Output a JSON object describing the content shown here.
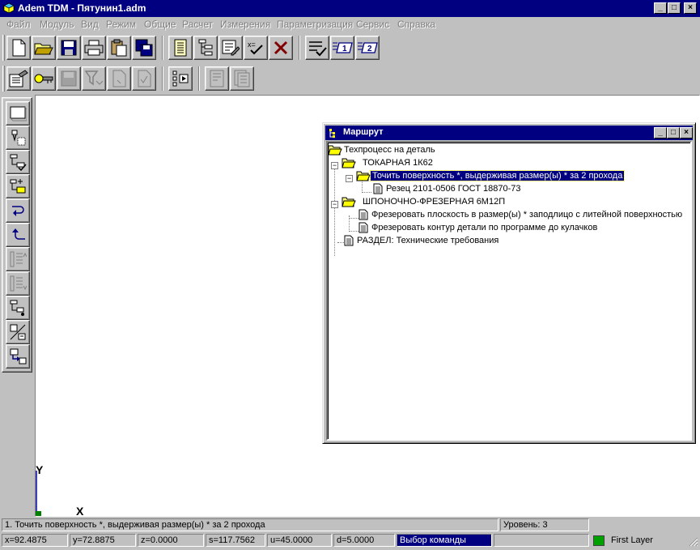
{
  "window": {
    "title": "Adem TDM - Пятунин1.adm",
    "minimize": "_",
    "maximize": "□",
    "close": "×"
  },
  "menu": [
    "Файл",
    "Модуль",
    "Вид",
    "Режим",
    "Общие",
    "Расчет",
    "Измерения",
    "Параметризация",
    "Сервис",
    "Справка"
  ],
  "toolbar1": {
    "buttons": [
      "new-file-icon",
      "open-folder-icon",
      "save-disk-icon",
      "print-icon",
      "paste-icon",
      "save-as-icon",
      "document-icon",
      "tree-icon",
      "edit-tree-icon",
      "formula-icon",
      "delete-icon",
      "checklist-icon",
      "level-1-icon",
      "level-2-icon"
    ],
    "label_level1": "1",
    "label_level2": "2",
    "label_formula": "x="
  },
  "toolbar2": {
    "buttons": [
      "properties-icon",
      "link-icon",
      "save-disabled-icon",
      "filter-disabled-icon",
      "page-disabled-icon",
      "check-disabled-icon",
      "list-run-icon",
      "page-sheet-disabled-icon",
      "report-disabled-icon"
    ]
  },
  "left_toolbar": {
    "buttons": [
      "frame-icon",
      "operation-add-icon",
      "route-check-icon",
      "insert-step-icon",
      "arrow-down-icon",
      "arrow-up-icon",
      "move-up-disabled-icon",
      "move-down-disabled-icon",
      "tool-path-icon",
      "measure-icon",
      "copy-ops-icon"
    ]
  },
  "axes": {
    "y": "Y",
    "x": "X"
  },
  "route": {
    "title": "Маршрут",
    "tree": [
      {
        "label": "Техпроцесс на деталь",
        "icon": "open-folder-icon"
      },
      {
        "label": "ТОКАРНАЯ 1К62",
        "icon": "open-folder-icon"
      },
      {
        "label": "Точить поверхность *, выдерживая размер(ы) * за 2 прохода",
        "icon": "open-folder-icon",
        "selected": true
      },
      {
        "label": "Резец 2101-0506  ГОСТ 18870-73",
        "icon": "document-icon"
      },
      {
        "label": "ШПОНОЧНО-ФРЕЗЕРНАЯ 6М12П",
        "icon": "open-folder-icon"
      },
      {
        "label": "Фрезеровать плоскость в размер(ы) * заподлицо с литейной поверхностью",
        "icon": "document-icon"
      },
      {
        "label": "Фрезеровать контур детали по программе до кулачков",
        "icon": "document-icon"
      },
      {
        "label": "РАЗДЕЛ: Технические требования",
        "icon": "document-icon"
      }
    ]
  },
  "status": {
    "message": "1. Точить поверхность *, выдерживая размер(ы) * за 2 прохода",
    "level": "Уровень: 3",
    "x": "x=92.4875",
    "y": "y=72.8875",
    "z": "z=0.0000",
    "s": "s=117.7562",
    "u": "u=45.0000",
    "d": "d=5.0000",
    "command": "Выбор команды",
    "layer": "First Layer",
    "layer_color": "#00a000"
  }
}
